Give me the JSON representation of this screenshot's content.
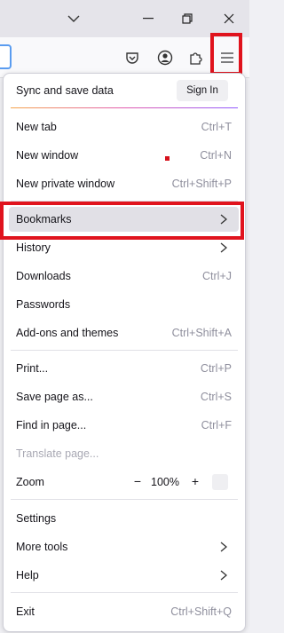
{
  "menu": {
    "sync_label": "Sync and save data",
    "signin_label": "Sign In",
    "new_tab": {
      "label": "New tab",
      "shortcut": "Ctrl+T"
    },
    "new_window": {
      "label": "New window",
      "shortcut": "Ctrl+N"
    },
    "new_private_window": {
      "label": "New private window",
      "shortcut": "Ctrl+Shift+P"
    },
    "bookmarks": {
      "label": "Bookmarks"
    },
    "history": {
      "label": "History"
    },
    "downloads": {
      "label": "Downloads",
      "shortcut": "Ctrl+J"
    },
    "passwords": {
      "label": "Passwords"
    },
    "addons": {
      "label": "Add-ons and themes",
      "shortcut": "Ctrl+Shift+A"
    },
    "print": {
      "label": "Print...",
      "shortcut": "Ctrl+P"
    },
    "save_page": {
      "label": "Save page as...",
      "shortcut": "Ctrl+S"
    },
    "find_in_page": {
      "label": "Find in page...",
      "shortcut": "Ctrl+F"
    },
    "translate_page": {
      "label": "Translate page..."
    },
    "zoom": {
      "label": "Zoom",
      "value": "100%",
      "minus": "−",
      "plus": "+"
    },
    "settings": {
      "label": "Settings"
    },
    "more_tools": {
      "label": "More tools"
    },
    "help": {
      "label": "Help"
    },
    "exit": {
      "label": "Exit",
      "shortcut": "Ctrl+Shift+Q"
    }
  },
  "icons": {
    "titlebar": [
      "chevron-down-icon",
      "minimize-icon",
      "restore-icon",
      "close-icon"
    ],
    "toolbar": [
      "pocket-icon",
      "account-icon",
      "extensions-icon",
      "hamburger-menu-icon"
    ]
  },
  "colors": {
    "highlight": "#e0131d",
    "focus_ring": "#5a9cf0",
    "disabled_text": "#a8a8b3",
    "shortcut_text": "#8f8f9d"
  }
}
